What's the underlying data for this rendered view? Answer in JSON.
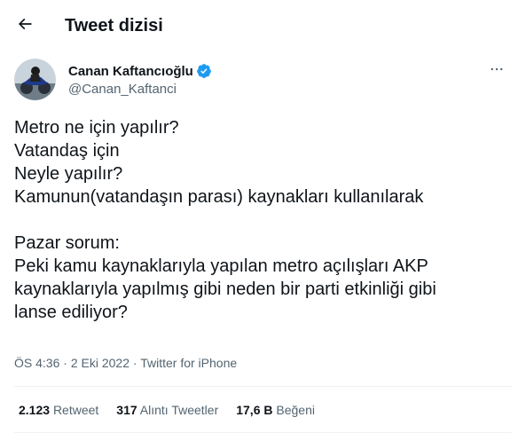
{
  "header": {
    "title": "Tweet dizisi",
    "back_icon": "arrow-left-icon"
  },
  "author": {
    "display_name": "Canan Kaftancıoğlu",
    "handle": "@Canan_Kaftanci",
    "verified_icon": "verified-badge-icon",
    "more_icon": "more-horizontal-icon"
  },
  "tweet": {
    "lines": [
      "Metro ne için yapılır?",
      "Vatandaş için",
      "Neyle yapılır?",
      "Kamunun(vatandaşın parası) kaynakları kullanılarak",
      "",
      "Pazar sorum:",
      "Peki kamu kaynaklarıyla yapılan metro açılışları AKP",
      "kaynaklarıyla yapılmış gibi neden bir parti etkinliği gibi",
      "lanse ediliyor?"
    ]
  },
  "meta": {
    "time": "ÖS 4:36",
    "separator": " · ",
    "date": "2 Eki 2022",
    "source": "Twitter for iPhone"
  },
  "stats": {
    "retweets_count": "2.123",
    "retweets_label": "Retweet",
    "quotes_count": "317",
    "quotes_label": "Alıntı Tweetler",
    "likes_count": "17,6 B",
    "likes_label": "Beğeni"
  },
  "colors": {
    "text_primary": "#0f1419",
    "text_secondary": "#536471",
    "verified_blue": "#1d9bf0",
    "divider": "#eff3f4"
  }
}
